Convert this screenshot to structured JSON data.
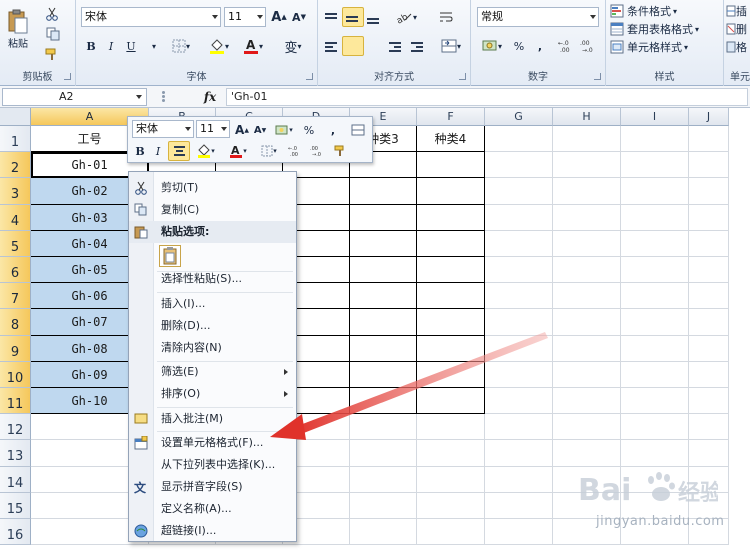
{
  "ribbon": {
    "clipboard": {
      "paste_label": "粘贴",
      "group_label": "剪贴板"
    },
    "font": {
      "font_name": "宋体",
      "font_size": "11",
      "group_label": "字体",
      "bold": "B",
      "italic": "I",
      "underline": "U",
      "phonetic": "变"
    },
    "alignment": {
      "group_label": "对齐方式"
    },
    "number": {
      "format": "常规",
      "percent": "%",
      "comma": ",",
      "group_label": "数字"
    },
    "styles": {
      "conditional": "条件格式",
      "table_format": "套用表格格式",
      "cell_styles": "单元格样式",
      "group_label": "样式"
    },
    "cells": {
      "group_label": "单元",
      "insert_partial": "插",
      "delete_partial": "删",
      "format_partial": "格"
    }
  },
  "formula_bar": {
    "name_box": "A2",
    "fx": "fx",
    "formula": "'Gh-01"
  },
  "sheet": {
    "columns": [
      "A",
      "B",
      "C",
      "D",
      "E",
      "F",
      "G",
      "H",
      "I",
      "J"
    ],
    "rows": [
      "1",
      "2",
      "3",
      "4",
      "5",
      "6",
      "7",
      "8",
      "9",
      "10",
      "11",
      "12",
      "13",
      "14",
      "15",
      "16"
    ],
    "header_row": {
      "A": "工号",
      "E": "种类3",
      "F": "种类4"
    },
    "column_a": [
      "Gh-01",
      "Gh-02",
      "Gh-03",
      "Gh-04",
      "Gh-05",
      "Gh-06",
      "Gh-07",
      "Gh-08",
      "Gh-09",
      "Gh-10"
    ]
  },
  "mini_toolbar": {
    "font_name": "宋体",
    "font_size": "11",
    "bold": "B",
    "italic": "I",
    "percent": "%",
    "comma": ","
  },
  "context_menu": {
    "items": [
      {
        "label": "剪切(T)",
        "icon": "scissors-icon"
      },
      {
        "label": "复制(C)",
        "icon": "copy-icon"
      },
      {
        "label": "粘贴选项:",
        "icon": "paste-icon"
      },
      {
        "label": "选择性粘贴(S)..."
      },
      {
        "label": "插入(I)..."
      },
      {
        "label": "删除(D)..."
      },
      {
        "label": "清除内容(N)"
      },
      {
        "label": "筛选(E)",
        "submenu": true
      },
      {
        "label": "排序(O)",
        "submenu": true
      },
      {
        "label": "插入批注(M)",
        "icon": "comment-icon"
      },
      {
        "label": "设置单元格格式(F)...",
        "icon": "format-cells-icon"
      },
      {
        "label": "从下拉列表中选择(K)..."
      },
      {
        "label": "显示拼音字段(S)",
        "icon": "phonetic-icon"
      },
      {
        "label": "定义名称(A)..."
      },
      {
        "label": "超链接(I)...",
        "icon": "hyperlink-icon"
      }
    ]
  },
  "watermark": {
    "text": "jingyan.baidu.com",
    "brand": "Baidu经验"
  },
  "colors": {
    "selection": "#bfd8ef",
    "header_active": "#f5c75b",
    "arrow": "#e0322b"
  }
}
